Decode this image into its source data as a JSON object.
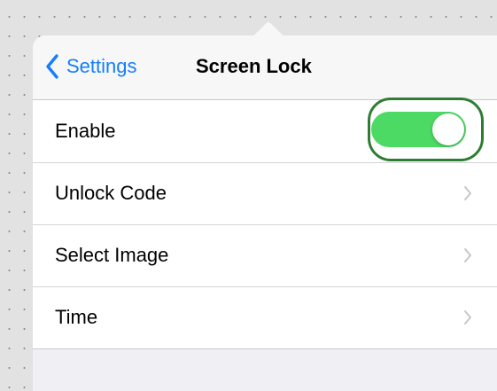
{
  "navbar": {
    "back_label": "Settings",
    "title": "Screen Lock"
  },
  "rows": [
    {
      "label": "Enable",
      "control": "toggle",
      "toggle_on": true
    },
    {
      "label": "Unlock Code",
      "control": "chevron"
    },
    {
      "label": "Select Image",
      "control": "chevron"
    },
    {
      "label": "Time",
      "control": "chevron"
    }
  ],
  "colors": {
    "accent": "#157efb",
    "toggle_on": "#4cd964",
    "highlight_ring": "#2e7d32",
    "chevron": "#c7c7cc"
  },
  "icons": {
    "back": "chevron-left-icon",
    "disclosure": "chevron-right-icon"
  }
}
